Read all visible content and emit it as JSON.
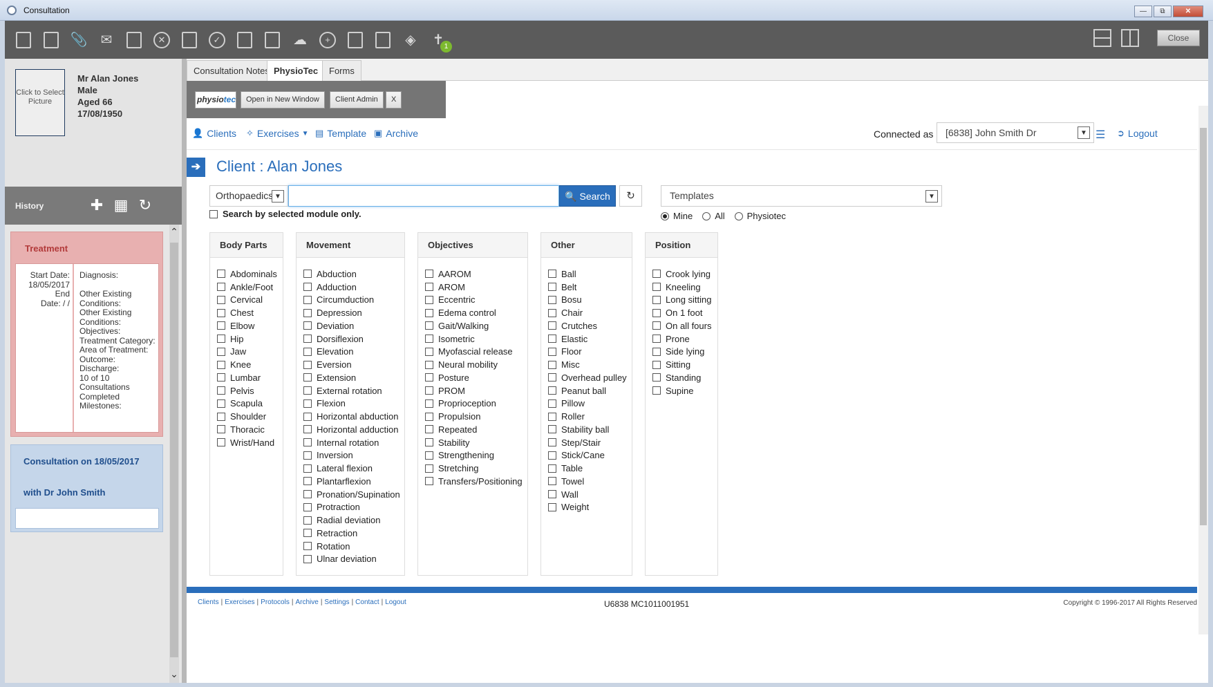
{
  "window": {
    "title": "Consultation"
  },
  "toolbar": {
    "badge_count": "1",
    "close_label": "Close",
    "icons": [
      "notes-icon",
      "clipboard-icon",
      "attach-icon",
      "mail-icon",
      "save-icon",
      "cancel-icon",
      "print-icon",
      "check-icon",
      "edit-icon",
      "lock-icon",
      "group-icon",
      "add-icon",
      "folder-lock-icon",
      "inbox-icon",
      "grid-icon",
      "physio-icon"
    ]
  },
  "patient": {
    "picture_label": "Click to Select Picture",
    "name": "Mr Alan Jones",
    "sex": "Male",
    "age": "Aged 66",
    "dob": "17/08/1950"
  },
  "history": {
    "label": "History",
    "treatment": {
      "title": "Treatment",
      "left": "Start Date:\n18/05/2017\nEnd\nDate: / /",
      "right": "Diagnosis:\n\nOther Existing Conditions:\nOther Existing Conditions:\nObjectives:\nTreatment Category:\nArea of Treatment:\nOutcome:\nDischarge:\n10 of 10 Consultations Completed\nMilestones:"
    },
    "consultation": {
      "line1": "Consultation on 18/05/2017",
      "line2": "with Dr John Smith"
    }
  },
  "tabs": [
    "Consultation Notes",
    "PhysioTec",
    "Forms"
  ],
  "physiotec_bar": {
    "logo_a": "physio",
    "logo_b": "tec",
    "open_new_window": "Open in New Window",
    "client_admin": "Client Admin",
    "close_x": "X"
  },
  "nav": {
    "clients": "Clients",
    "exercises": "Exercises",
    "template": "Template",
    "archive": "Archive",
    "connected_as_label": "Connected as",
    "connected_as_value": "[6838] John Smith Dr",
    "logout": "Logout"
  },
  "client": {
    "title": "Client : Alan Jones"
  },
  "search": {
    "module": "Orthopaedics",
    "query": "",
    "button": "Search",
    "module_only_label": "Search by selected module only.",
    "templates_label": "Templates",
    "radio_options": [
      "Mine",
      "All",
      "Physiotec"
    ],
    "radio_selected": "Mine"
  },
  "filters": [
    {
      "title": "Body Parts",
      "items": [
        "Abdominals",
        "Ankle/Foot",
        "Cervical",
        "Chest",
        "Elbow",
        "Hip",
        "Jaw",
        "Knee",
        "Lumbar",
        "Pelvis",
        "Scapula",
        "Shoulder",
        "Thoracic",
        "Wrist/Hand"
      ]
    },
    {
      "title": "Movement",
      "items": [
        "Abduction",
        "Adduction",
        "Circumduction",
        "Depression",
        "Deviation",
        "Dorsiflexion",
        "Elevation",
        "Eversion",
        "Extension",
        "External rotation",
        "Flexion",
        "Horizontal abduction",
        "Horizontal adduction",
        "Internal rotation",
        "Inversion",
        "Lateral flexion",
        "Plantarflexion",
        "Pronation/Supination",
        "Protraction",
        "Radial deviation",
        "Retraction",
        "Rotation",
        "Ulnar deviation"
      ]
    },
    {
      "title": "Objectives",
      "items": [
        "AAROM",
        "AROM",
        "Eccentric",
        "Edema control",
        "Gait/Walking",
        "Isometric",
        "Myofascial release",
        "Neural mobility",
        "Posture",
        "PROM",
        "Proprioception",
        "Propulsion",
        "Repeated",
        "Stability",
        "Strengthening",
        "Stretching",
        "Transfers/Positioning"
      ]
    },
    {
      "title": "Other",
      "items": [
        "Ball",
        "Belt",
        "Bosu",
        "Chair",
        "Crutches",
        "Elastic",
        "Floor",
        "Misc",
        "Overhead pulley",
        "Peanut ball",
        "Pillow",
        "Roller",
        "Stability ball",
        "Step/Stair",
        "Stick/Cane",
        "Table",
        "Towel",
        "Wall",
        "Weight"
      ]
    },
    {
      "title": "Position",
      "items": [
        "Crook lying",
        "Kneeling",
        "Long sitting",
        "On 1 foot",
        "On all fours",
        "Prone",
        "Side lying",
        "Sitting",
        "Standing",
        "Supine"
      ]
    }
  ],
  "footer": {
    "links": [
      "Clients",
      "Exercises",
      "Protocols",
      "Archive",
      "Settings",
      "Contact",
      "Logout"
    ],
    "code": "U6838 MC1011001951",
    "copyright": "Copyright © 1996-2017 All Rights Reserved"
  }
}
